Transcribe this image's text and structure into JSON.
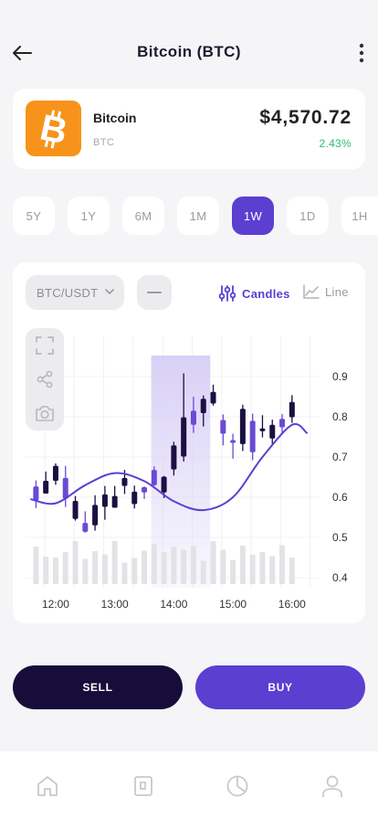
{
  "header": {
    "title": "Bitcoin (BTC)",
    "back_icon": "arrow-left-icon",
    "menu_icon": "more-vertical-icon"
  },
  "coin": {
    "name": "Bitcoin",
    "symbol": "BTC",
    "price": "$4,570.72",
    "change": "2.43%",
    "logo_icon": "bitcoin-icon",
    "logo_color": "#f7931a",
    "change_color": "#2eb872"
  },
  "timeframes": {
    "options": [
      "5Y",
      "1Y",
      "6M",
      "1M",
      "1W",
      "1D",
      "1H"
    ],
    "selected": "1W"
  },
  "chart_controls": {
    "pair": "BTC/USDT",
    "candles_label": "Candles",
    "line_label": "Line",
    "selected_mode": "Candles",
    "tools": [
      "fullscreen-icon",
      "share-icon",
      "camera-icon"
    ]
  },
  "chart_data": {
    "type": "candlestick",
    "title": "",
    "xlabel": "",
    "ylabel": "",
    "x_ticks": [
      "12:00",
      "13:00",
      "14:00",
      "15:00",
      "16:00"
    ],
    "y_ticks": [
      "0.9",
      "0.8",
      "0.7",
      "0.6",
      "0.5",
      "0.4"
    ],
    "ylim": [
      0.4,
      0.9
    ],
    "grid": true,
    "highlight_range": [
      "13:37",
      "14:37"
    ],
    "candles": [
      {
        "t": "11:40",
        "o": 0.627,
        "h": 0.642,
        "l": 0.573,
        "c": 0.592,
        "dir": "up"
      },
      {
        "t": "11:50",
        "o": 0.641,
        "h": 0.664,
        "l": 0.61,
        "c": 0.609,
        "dir": "down"
      },
      {
        "t": "12:00",
        "o": 0.678,
        "h": 0.684,
        "l": 0.631,
        "c": 0.641,
        "dir": "down"
      },
      {
        "t": "12:10",
        "o": 0.648,
        "h": 0.678,
        "l": 0.576,
        "c": 0.597,
        "dir": "up"
      },
      {
        "t": "12:20",
        "o": 0.591,
        "h": 0.603,
        "l": 0.542,
        "c": 0.546,
        "dir": "down"
      },
      {
        "t": "12:30",
        "o": 0.536,
        "h": 0.565,
        "l": 0.512,
        "c": 0.514,
        "dir": "up"
      },
      {
        "t": "12:40",
        "o": 0.53,
        "h": 0.605,
        "l": 0.517,
        "c": 0.581,
        "dir": "down"
      },
      {
        "t": "12:50",
        "o": 0.576,
        "h": 0.628,
        "l": 0.544,
        "c": 0.607,
        "dir": "down"
      },
      {
        "t": "13:00",
        "o": 0.603,
        "h": 0.628,
        "l": 0.576,
        "c": 0.574,
        "dir": "down"
      },
      {
        "t": "13:10",
        "o": 0.628,
        "h": 0.668,
        "l": 0.608,
        "c": 0.648,
        "dir": "down"
      },
      {
        "t": "13:20",
        "o": 0.614,
        "h": 0.629,
        "l": 0.572,
        "c": 0.583,
        "dir": "down"
      },
      {
        "t": "13:30",
        "o": 0.612,
        "h": 0.627,
        "l": 0.596,
        "c": 0.625,
        "dir": "up"
      },
      {
        "t": "13:40",
        "o": 0.668,
        "h": 0.677,
        "l": 0.628,
        "c": 0.63,
        "dir": "up"
      },
      {
        "t": "13:50",
        "o": 0.651,
        "h": 0.653,
        "l": 0.598,
        "c": 0.612,
        "dir": "down"
      },
      {
        "t": "14:00",
        "o": 0.669,
        "h": 0.738,
        "l": 0.654,
        "c": 0.729,
        "dir": "down"
      },
      {
        "t": "14:10",
        "o": 0.701,
        "h": 0.908,
        "l": 0.689,
        "c": 0.799,
        "dir": "down"
      },
      {
        "t": "14:20",
        "o": 0.815,
        "h": 0.85,
        "l": 0.76,
        "c": 0.78,
        "dir": "up"
      },
      {
        "t": "14:30",
        "o": 0.809,
        "h": 0.853,
        "l": 0.776,
        "c": 0.845,
        "dir": "down"
      },
      {
        "t": "14:40",
        "o": 0.862,
        "h": 0.88,
        "l": 0.828,
        "c": 0.833,
        "dir": "down"
      },
      {
        "t": "14:50",
        "o": 0.792,
        "h": 0.806,
        "l": 0.729,
        "c": 0.758,
        "dir": "up"
      },
      {
        "t": "15:00",
        "o": 0.74,
        "h": 0.758,
        "l": 0.696,
        "c": 0.742,
        "dir": "up"
      },
      {
        "t": "15:10",
        "o": 0.82,
        "h": 0.83,
        "l": 0.715,
        "c": 0.732,
        "dir": "down"
      },
      {
        "t": "15:20",
        "o": 0.79,
        "h": 0.808,
        "l": 0.692,
        "c": 0.712,
        "dir": "up"
      },
      {
        "t": "15:30",
        "o": 0.771,
        "h": 0.804,
        "l": 0.749,
        "c": 0.765,
        "dir": "down"
      },
      {
        "t": "15:40",
        "o": 0.78,
        "h": 0.793,
        "l": 0.729,
        "c": 0.746,
        "dir": "down"
      },
      {
        "t": "15:50",
        "o": 0.795,
        "h": 0.807,
        "l": 0.76,
        "c": 0.774,
        "dir": "up"
      },
      {
        "t": "16:00",
        "o": 0.837,
        "h": 0.854,
        "l": 0.785,
        "c": 0.799,
        "dir": "down"
      }
    ],
    "line_series": {
      "name": "",
      "x": [
        "11:35",
        "12:00",
        "12:30",
        "13:00",
        "13:30",
        "14:00",
        "14:30",
        "15:00",
        "15:30",
        "16:00",
        "16:15"
      ],
      "y": [
        0.595,
        0.585,
        0.63,
        0.66,
        0.64,
        0.59,
        0.568,
        0.6,
        0.7,
        0.78,
        0.76
      ]
    },
    "volume": [
      0.82,
      0.6,
      0.58,
      0.7,
      0.94,
      0.55,
      0.72,
      0.65,
      0.94,
      0.47,
      0.57,
      0.73,
      0.88,
      0.7,
      0.82,
      0.75,
      0.84,
      0.51,
      0.94,
      0.75,
      0.52,
      0.84,
      0.64,
      0.7,
      0.61,
      0.85,
      0.58
    ]
  },
  "actions": {
    "sell_label": "SELL",
    "buy_label": "BUY",
    "sell_color": "#160d3a",
    "buy_color": "#5a3fd1"
  },
  "bottom_nav": {
    "items": [
      "home-icon",
      "wallet-icon",
      "pie-chart-icon",
      "user-icon"
    ]
  },
  "colors": {
    "accent": "#5a3fd1",
    "dark_candle": "#1c0f42",
    "purple_candle": "#6a4ad6",
    "highlight": "#d8d0f6"
  }
}
